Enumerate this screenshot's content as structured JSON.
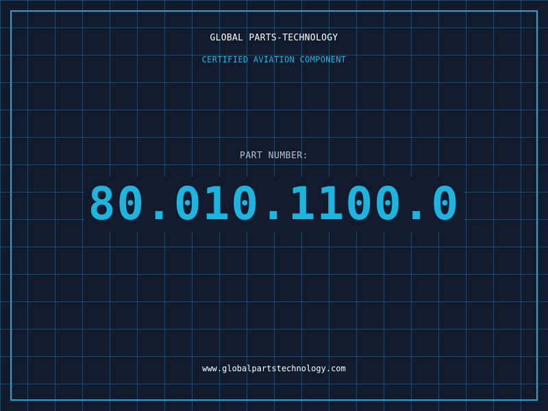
{
  "header": {
    "brand": "GLOBAL PARTS-TECHNOLOGY",
    "tagline": "CERTIFIED AVIATION COMPONENT"
  },
  "part": {
    "label": "PART NUMBER:",
    "number": "80.010.1100.0"
  },
  "footer": {
    "website": "www.globalpartstechnology.com"
  },
  "colors": {
    "background": "#121a2e",
    "grid": "#286e8c",
    "accent": "#1eb4e0",
    "text": "#ffffff"
  }
}
